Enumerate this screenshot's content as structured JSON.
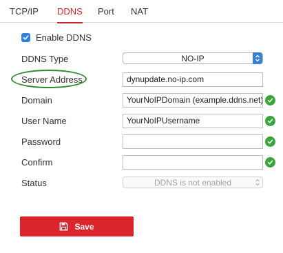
{
  "tabs": [
    {
      "label": "TCP/IP"
    },
    {
      "label": "DDNS"
    },
    {
      "label": "Port"
    },
    {
      "label": "NAT"
    }
  ],
  "active_tab": "DDNS",
  "enable_ddns": {
    "label": "Enable DDNS",
    "checked": true
  },
  "form": {
    "ddns_type": {
      "label": "DDNS Type",
      "value": "NO-IP"
    },
    "server_address": {
      "label": "Server Address",
      "value": "dynupdate.no-ip.com"
    },
    "domain": {
      "label": "Domain",
      "value": "YourNoIPDomain (example.ddns.net)",
      "valid": true
    },
    "user_name": {
      "label": "User Name",
      "value": "YourNoIPUsername",
      "valid": true
    },
    "password": {
      "label": "Password",
      "value": "",
      "valid": true
    },
    "confirm": {
      "label": "Confirm",
      "value": "",
      "valid": true
    },
    "status": {
      "label": "Status",
      "value": "DDNS is not enabled"
    }
  },
  "save_label": "Save",
  "colors": {
    "accent_red": "#d9252b",
    "checkbox_blue": "#2f80d8",
    "valid_green": "#3aa53a",
    "highlight_oval": "#2e8b2e"
  },
  "icons": [
    "checkbox-checked-icon",
    "select-arrows-icon",
    "valid-check-icon",
    "save-disk-icon"
  ]
}
